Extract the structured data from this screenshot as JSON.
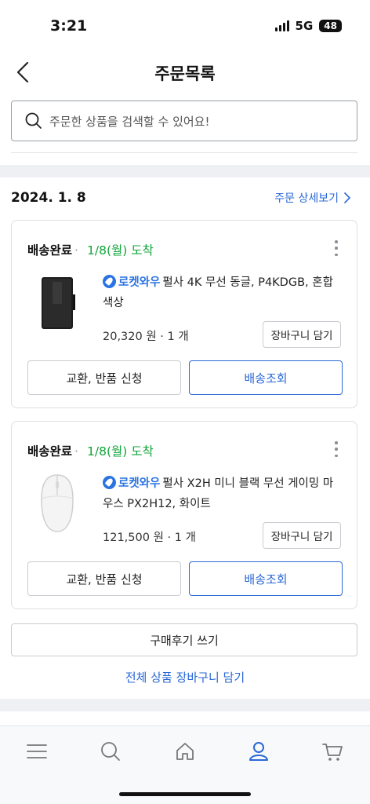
{
  "status_bar": {
    "time": "3:21",
    "network": "5G",
    "battery": "48"
  },
  "nav": {
    "title": "주문목록",
    "back_icon": "chevron-left-icon"
  },
  "search": {
    "placeholder": "주문한 상품을 검색할 수 있어요!",
    "icon": "search-icon"
  },
  "order": {
    "date": "2024. 1. 8",
    "detail_link": "주문 상세보기",
    "items": [
      {
        "status": "배송완료",
        "arrival": "1/8(월) 도착",
        "badge": "로켓와우",
        "name": "펄사 4K 무선 동글, P4KDGB, 혼합 색상",
        "price": "20,320 원 · 1 개",
        "cart_label": "장바구니 담기",
        "exchange_label": "교환, 반품 신청",
        "track_label": "배송조회"
      },
      {
        "status": "배송완료",
        "arrival": "1/8(월) 도착",
        "badge": "로켓와우",
        "name": "펄사 X2H 미니 블랙 무선 게이밍 마우스 PX2H12, 화이트",
        "price": "121,500 원 · 1 개",
        "cart_label": "장바구니 담기",
        "exchange_label": "교환, 반품 신청",
        "track_label": "배송조회"
      }
    ],
    "review_label": "구매후기 쓰기",
    "add_all_label": "전체 상품 장바구니 담기"
  },
  "tabbar": {
    "icons": [
      "menu-icon",
      "search-icon",
      "home-icon",
      "user-icon",
      "cart-icon"
    ],
    "active": "user-icon"
  },
  "colors": {
    "accent": "#2a68d6",
    "arrival_green": "#12a53a",
    "rocket_blue": "#2a73e2"
  }
}
